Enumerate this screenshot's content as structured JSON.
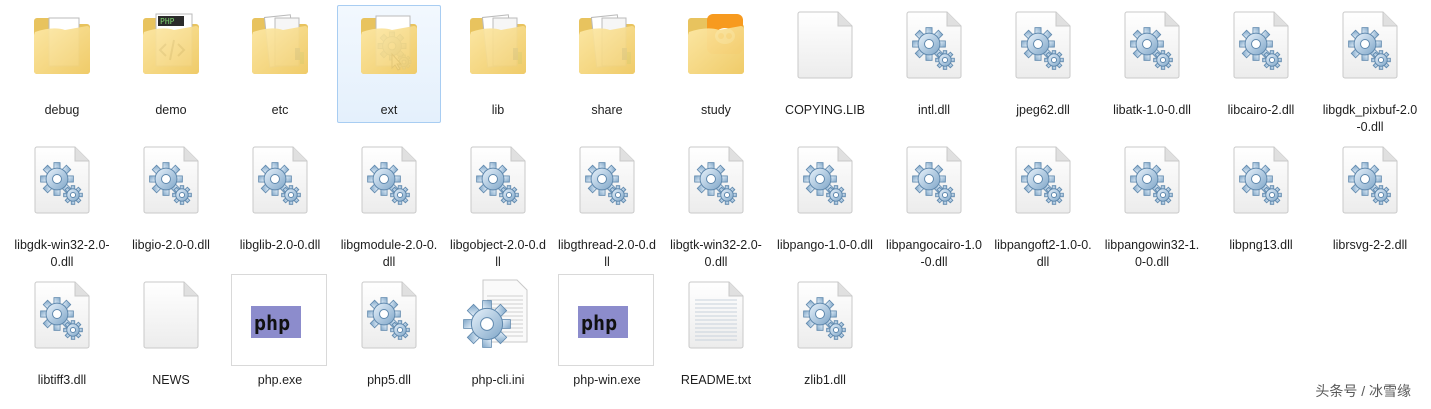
{
  "files": [
    {
      "name": "debug",
      "icon": "folder-icon",
      "kind": "folder"
    },
    {
      "name": "demo",
      "icon": "folder-php-icon",
      "kind": "folder-php"
    },
    {
      "name": "etc",
      "icon": "folder-icon",
      "kind": "folder-docs"
    },
    {
      "name": "ext",
      "icon": "folder-gear-icon",
      "kind": "folder-gear",
      "selected": true
    },
    {
      "name": "lib",
      "icon": "folder-icon",
      "kind": "folder-docs"
    },
    {
      "name": "share",
      "icon": "folder-icon",
      "kind": "folder-docs"
    },
    {
      "name": "study",
      "icon": "folder-uc-icon",
      "kind": "folder-uc"
    },
    {
      "name": "COPYING.LIB",
      "icon": "blank-file-icon",
      "kind": "blank"
    },
    {
      "name": "intl.dll",
      "icon": "dll-file-icon",
      "kind": "dll"
    },
    {
      "name": "jpeg62.dll",
      "icon": "dll-file-icon",
      "kind": "dll"
    },
    {
      "name": "libatk-1.0-0.dll",
      "icon": "dll-file-icon",
      "kind": "dll"
    },
    {
      "name": "libcairo-2.dll",
      "icon": "dll-file-icon",
      "kind": "dll"
    },
    {
      "name": "libgdk_pixbuf-2.0-0.dll",
      "icon": "dll-file-icon",
      "kind": "dll"
    },
    {
      "name": "libgdk-win32-2.0-0.dll",
      "icon": "dll-file-icon",
      "kind": "dll"
    },
    {
      "name": "libgio-2.0-0.dll",
      "icon": "dll-file-icon",
      "kind": "dll"
    },
    {
      "name": "libglib-2.0-0.dll",
      "icon": "dll-file-icon",
      "kind": "dll"
    },
    {
      "name": "libgmodule-2.0-0.dll",
      "icon": "dll-file-icon",
      "kind": "dll"
    },
    {
      "name": "libgobject-2.0-0.dll",
      "icon": "dll-file-icon",
      "kind": "dll"
    },
    {
      "name": "libgthread-2.0-0.dll",
      "icon": "dll-file-icon",
      "kind": "dll"
    },
    {
      "name": "libgtk-win32-2.0-0.dll",
      "icon": "dll-file-icon",
      "kind": "dll"
    },
    {
      "name": "libpango-1.0-0.dll",
      "icon": "dll-file-icon",
      "kind": "dll"
    },
    {
      "name": "libpangocairo-1.0-0.dll",
      "icon": "dll-file-icon",
      "kind": "dll"
    },
    {
      "name": "libpangoft2-1.0-0.dll",
      "icon": "dll-file-icon",
      "kind": "dll"
    },
    {
      "name": "libpangowin32-1.0-0.dll",
      "icon": "dll-file-icon",
      "kind": "dll"
    },
    {
      "name": "libpng13.dll",
      "icon": "dll-file-icon",
      "kind": "dll"
    },
    {
      "name": "librsvg-2-2.dll",
      "icon": "dll-file-icon",
      "kind": "dll"
    },
    {
      "name": "libtiff3.dll",
      "icon": "dll-file-icon",
      "kind": "dll"
    },
    {
      "name": "NEWS",
      "icon": "blank-file-icon",
      "kind": "blank"
    },
    {
      "name": "php.exe",
      "icon": "php-exe-icon",
      "kind": "php-exe"
    },
    {
      "name": "php5.dll",
      "icon": "dll-file-icon",
      "kind": "dll"
    },
    {
      "name": "php-cli.ini",
      "icon": "ini-file-icon",
      "kind": "ini"
    },
    {
      "name": "php-win.exe",
      "icon": "php-exe-icon",
      "kind": "php-exe"
    },
    {
      "name": "README.txt",
      "icon": "text-file-icon",
      "kind": "text"
    },
    {
      "name": "zlib1.dll",
      "icon": "dll-file-icon",
      "kind": "dll"
    }
  ],
  "badges": {
    "php_text": "php",
    "folder_php_text": "PHP"
  },
  "watermark": "头条号 / 冰雪缘",
  "colors": {
    "selection_bg": "#e4f0fc",
    "selection_border": "#a8cdf2",
    "folder": "#f5d77e",
    "php_badge": "#8c8ccc"
  }
}
